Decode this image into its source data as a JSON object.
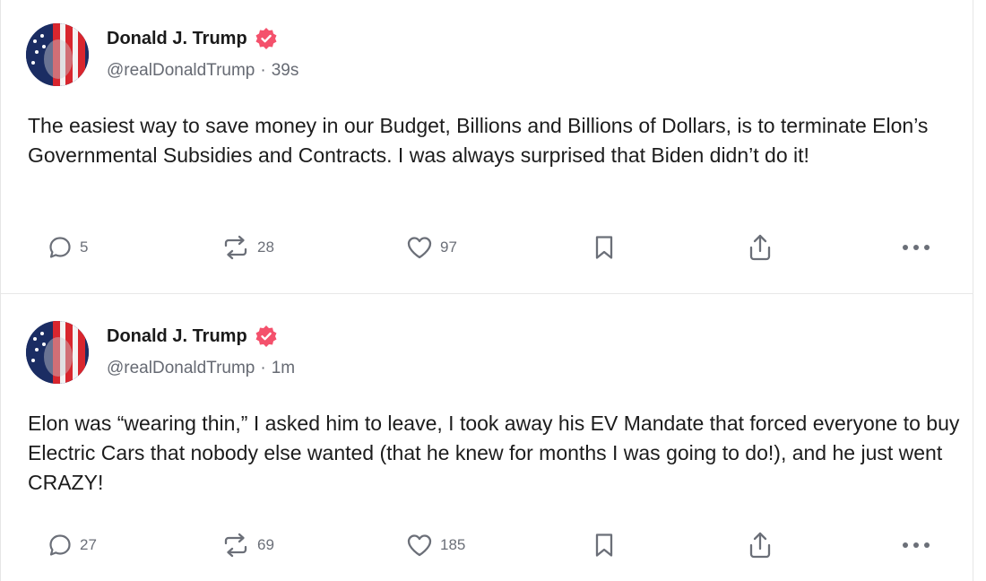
{
  "colors": {
    "verified_badge": "#f4516c",
    "text_primary": "#1a1a1a",
    "text_secondary": "#666a73",
    "icon": "#6b6f78",
    "divider": "#e8e8e8"
  },
  "posts": [
    {
      "author_name": "Donald J. Trump",
      "verified_icon": "verified-badge-icon",
      "handle": "@realDonaldTrump",
      "separator": "·",
      "time": "39s",
      "text": "The easiest way to save money in our Budget, Billions and Billions of Dollars, is to terminate Elon’s Governmental Subsidies and Contracts. I was always surprised that Biden didn’t do it!",
      "replies": "5",
      "reposts": "28",
      "likes": "97"
    },
    {
      "author_name": "Donald J. Trump",
      "verified_icon": "verified-badge-icon",
      "handle": "@realDonaldTrump",
      "separator": "·",
      "time": "1m",
      "text": "Elon was “wearing thin,” I asked him to leave, I took away his EV Mandate that forced everyone to buy Electric Cars that nobody else wanted (that he knew for months I was going to do!), and he just went CRAZY!",
      "replies": "27",
      "reposts": "69",
      "likes": "185"
    }
  ]
}
